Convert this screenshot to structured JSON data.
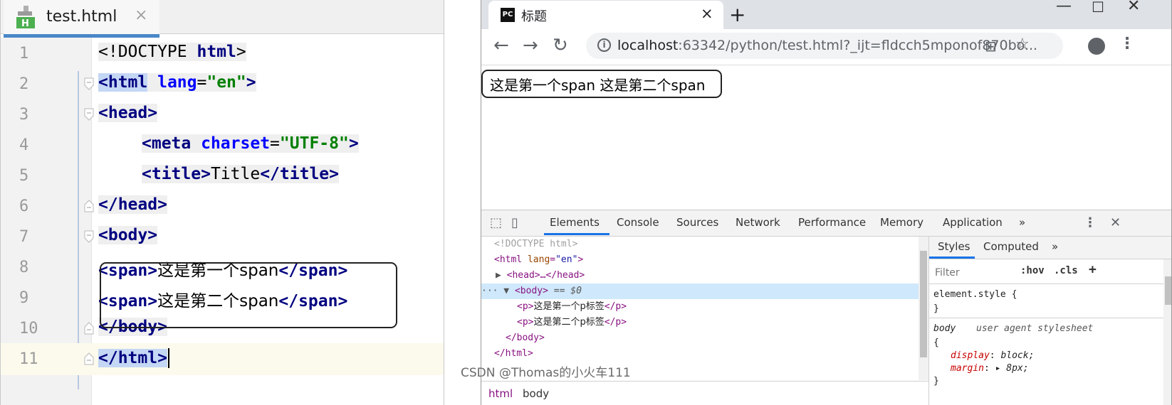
{
  "editor": {
    "tab_label": "test.html",
    "tab_close": "×",
    "lines": [
      {
        "num": "1"
      },
      {
        "num": "2"
      },
      {
        "num": "3"
      },
      {
        "num": "4"
      },
      {
        "num": "5"
      },
      {
        "num": "6"
      },
      {
        "num": "7"
      },
      {
        "num": "8"
      },
      {
        "num": "9"
      },
      {
        "num": "10"
      },
      {
        "num": "11"
      }
    ],
    "code": {
      "l1_a": "<!DOCTYPE ",
      "l1_b": "html",
      "l1_c": ">",
      "l2_a": "<html",
      "l2_b": " ",
      "l2_c": "lang",
      "l2_d": "=",
      "l2_e": "\"en\"",
      "l2_f": ">",
      "l3_a": "<head",
      "l3_b": ">",
      "l4_a": "<meta",
      "l4_b": " ",
      "l4_c": "charset",
      "l4_d": "=",
      "l4_e": "\"UTF-8\"",
      "l4_f": ">",
      "l5_a": "<title",
      "l5_b": ">",
      "l5_c": "Title",
      "l5_d": "</title",
      "l5_e": ">",
      "l6_a": "</head",
      "l6_b": ">",
      "l7_a": "<body",
      "l7_b": ">",
      "l8_a": "<span",
      "l8_b": ">",
      "l8_c": "这是第一个span",
      "l8_d": "</span",
      "l8_e": ">",
      "l9_a": "<span",
      "l9_b": ">",
      "l9_c": "这是第二个span",
      "l9_d": "</span",
      "l9_e": ">",
      "l10_a": "</body",
      "l10_b": ">",
      "l11_a": "</html",
      "l11_b": ">"
    }
  },
  "browser": {
    "tab_icon": "PC",
    "tab_title": "标题",
    "tab_close": "×",
    "new_tab": "+",
    "url_host": "localhost",
    "url_rest": ":63342/python/test.html?_ijt=fldcch5mponof870bo...",
    "page_text": "这是第一个span 这是第二个span",
    "devtools": {
      "tabs": [
        "Elements",
        "Console",
        "Sources",
        "Network",
        "Performance",
        "Memory",
        "Application",
        "»"
      ],
      "dom": {
        "doctype": "<!DOCTYPE html>",
        "html_open_tag": "<html",
        "html_attr": "lang",
        "html_val": "\"en\"",
        "head_collapsed": "<head>…</head>",
        "body_open": "<body>",
        "body_eq": "== $0",
        "p1_open": "<p>",
        "p1_text": "这是第一个p标签",
        "p1_close": "</p>",
        "p2_open": "<p>",
        "p2_text": "这是第二个p标签",
        "p2_close": "</p>",
        "body_close": "</body>",
        "html_close": "</html>"
      },
      "breadcrumbs": [
        "html",
        "body"
      ],
      "styles": {
        "tabs": [
          "Styles",
          "Computed",
          "»"
        ],
        "filter_placeholder": "Filter",
        "hov": ":hov",
        "cls": ".cls",
        "plus": "+",
        "element_style": "element.style {",
        "close_brace": "}",
        "body_selector": "body",
        "origin": "user agent stylesheet",
        "open_brace": "{",
        "prop1_name": "display",
        "prop1_val": "block;",
        "prop2_name": "margin",
        "prop2_val": "8px;"
      }
    }
  },
  "watermark": "CSDN @Thomas的小火车111"
}
